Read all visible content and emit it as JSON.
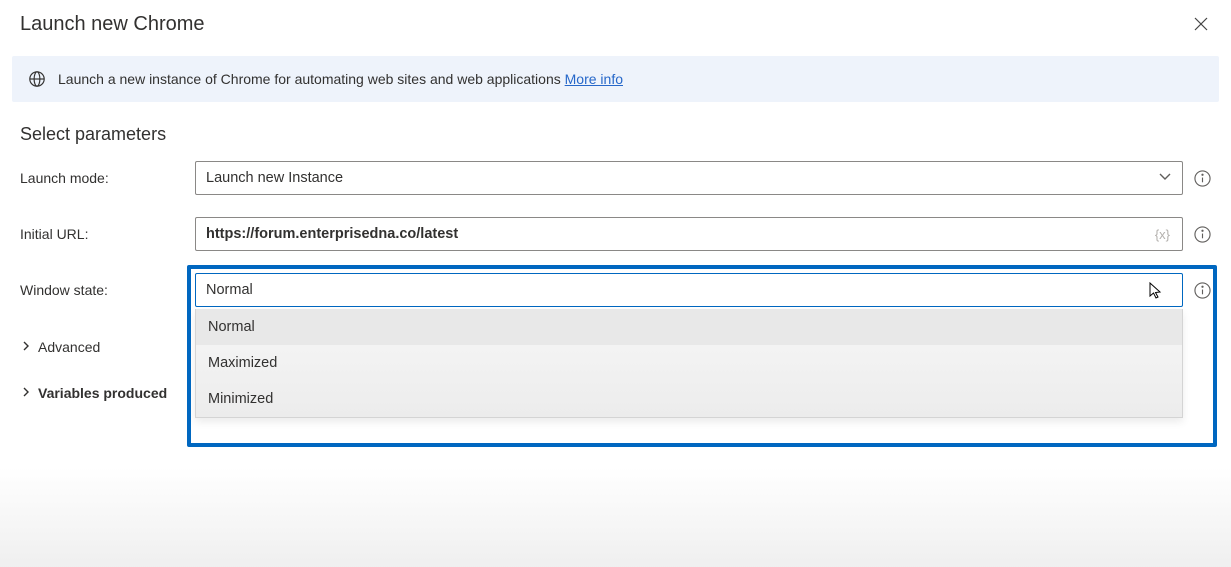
{
  "dialog": {
    "title": "Launch new Chrome"
  },
  "info_bar": {
    "text": "Launch a new instance of Chrome for automating web sites and web applications ",
    "link": "More info"
  },
  "section_title": "Select parameters",
  "fields": {
    "launch_mode": {
      "label": "Launch mode:",
      "value": "Launch new Instance"
    },
    "initial_url": {
      "label": "Initial URL:",
      "value": "https://forum.enterprisedna.co/latest",
      "var_token": "{x}"
    },
    "window_state": {
      "label": "Window state:",
      "value": "Normal",
      "options": [
        "Normal",
        "Maximized",
        "Minimized"
      ]
    }
  },
  "expanders": {
    "advanced": "Advanced",
    "variables": "Variables produced"
  }
}
